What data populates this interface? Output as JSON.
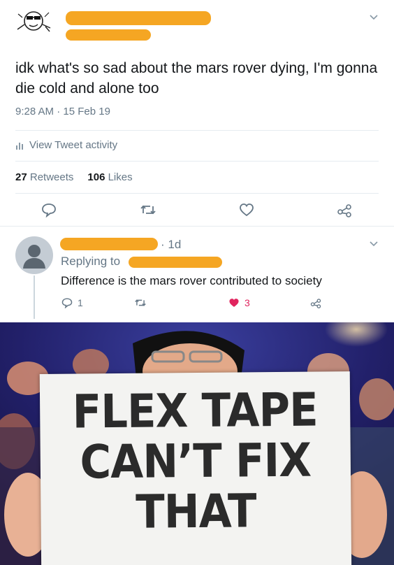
{
  "tweet": {
    "text": "idk what's so sad about the mars rover dying, I'm gonna die cold and alone too",
    "timestamp": "9:28 AM · 15 Feb 19",
    "activity_label": "View Tweet activity",
    "retweets_count": "27",
    "retweets_label": "Retweets",
    "likes_count": "106",
    "likes_label": "Likes"
  },
  "reply": {
    "age": "· 1d",
    "replying_label": "Replying to",
    "text": "Difference is the mars rover contributed to society",
    "reply_count": "1",
    "like_count": "3"
  },
  "photo": {
    "sign_lines": [
      "FLEX TAPE",
      "CAN’T FIX",
      "THAT"
    ]
  },
  "colors": {
    "redaction": "#f5a623",
    "muted": "#657786",
    "like_red": "#e0245e",
    "divider": "#e6ecf0"
  },
  "icons": [
    "chevron-down-icon",
    "bar-chart-icon",
    "reply-icon",
    "retweet-icon",
    "heart-icon",
    "share-icon",
    "default-avatar-icon"
  ]
}
